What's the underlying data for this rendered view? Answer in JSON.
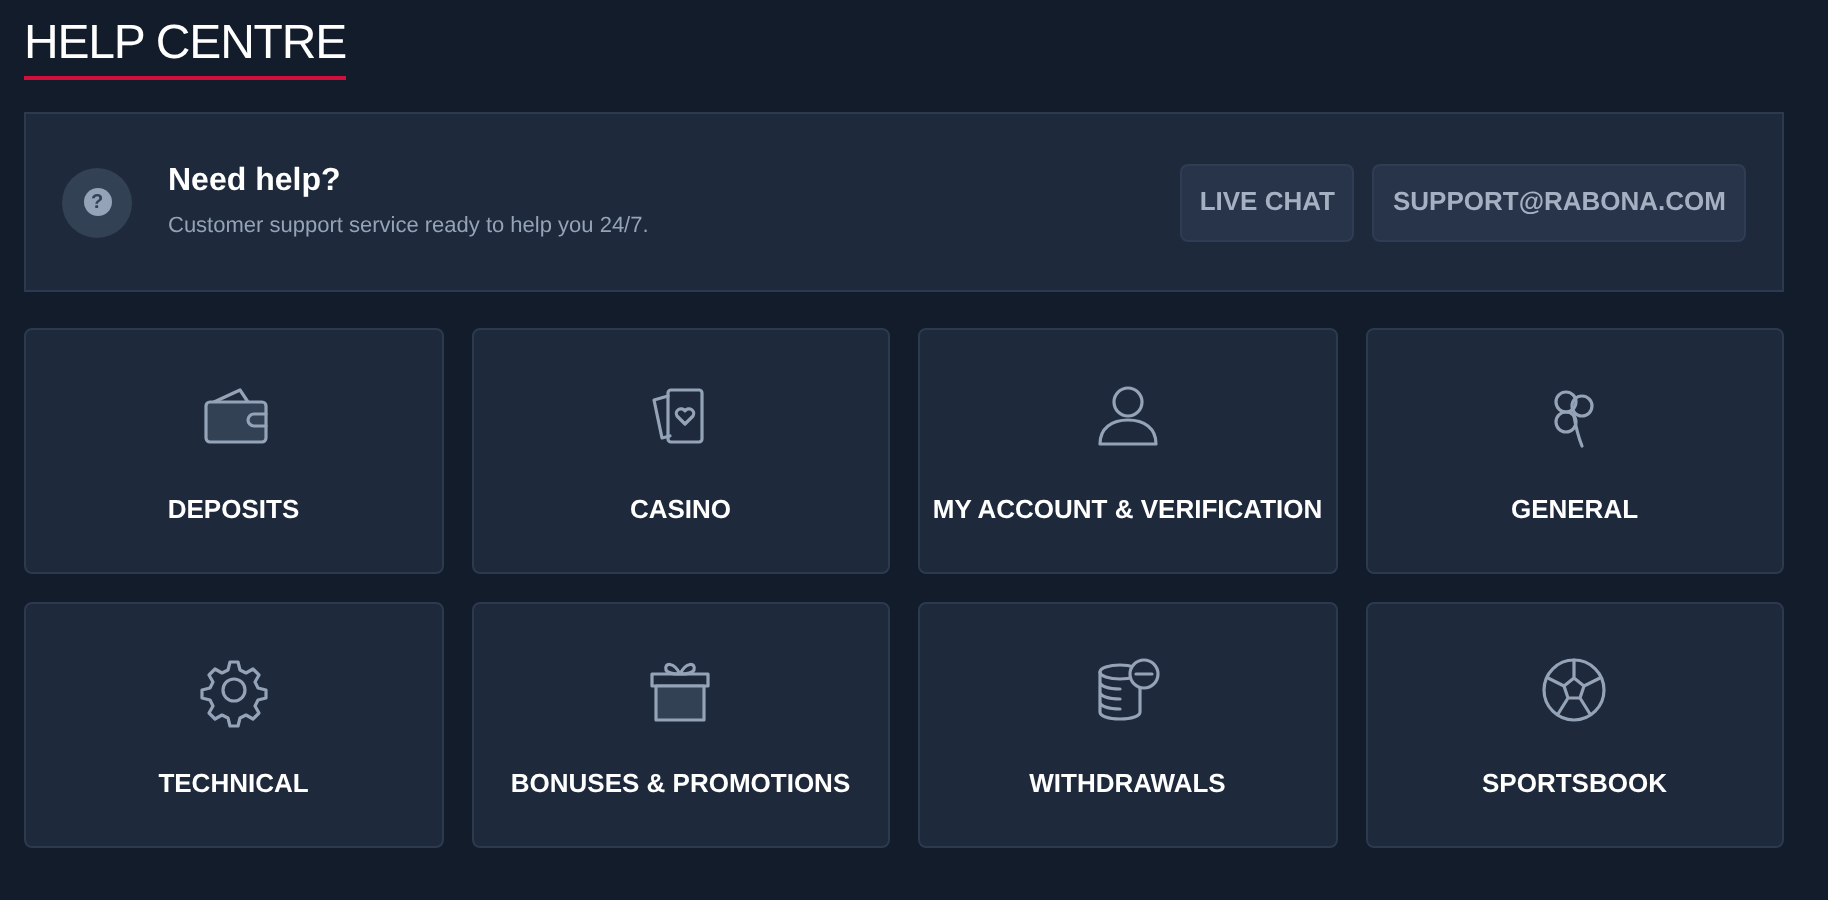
{
  "title": "HELP CENTRE",
  "help_banner": {
    "icon": "?",
    "heading": "Need help?",
    "text": "Customer support service ready to help you 24/7.",
    "buttons": [
      "LIVE CHAT",
      "SUPPORT@RABONA.COM"
    ]
  },
  "categories": [
    {
      "label": "DEPOSITS",
      "kind": "wallet"
    },
    {
      "label": "CASINO",
      "kind": "cards"
    },
    {
      "label": "MY ACCOUNT & VERIFICATION",
      "kind": "user"
    },
    {
      "label": "GENERAL",
      "kind": "clover"
    },
    {
      "label": "TECHNICAL",
      "kind": "gear"
    },
    {
      "label": "BONUSES & PROMOTIONS",
      "kind": "gift"
    },
    {
      "label": "WITHDRAWALS",
      "kind": "coins"
    },
    {
      "label": "SPORTSBOOK",
      "kind": "ball"
    }
  ]
}
